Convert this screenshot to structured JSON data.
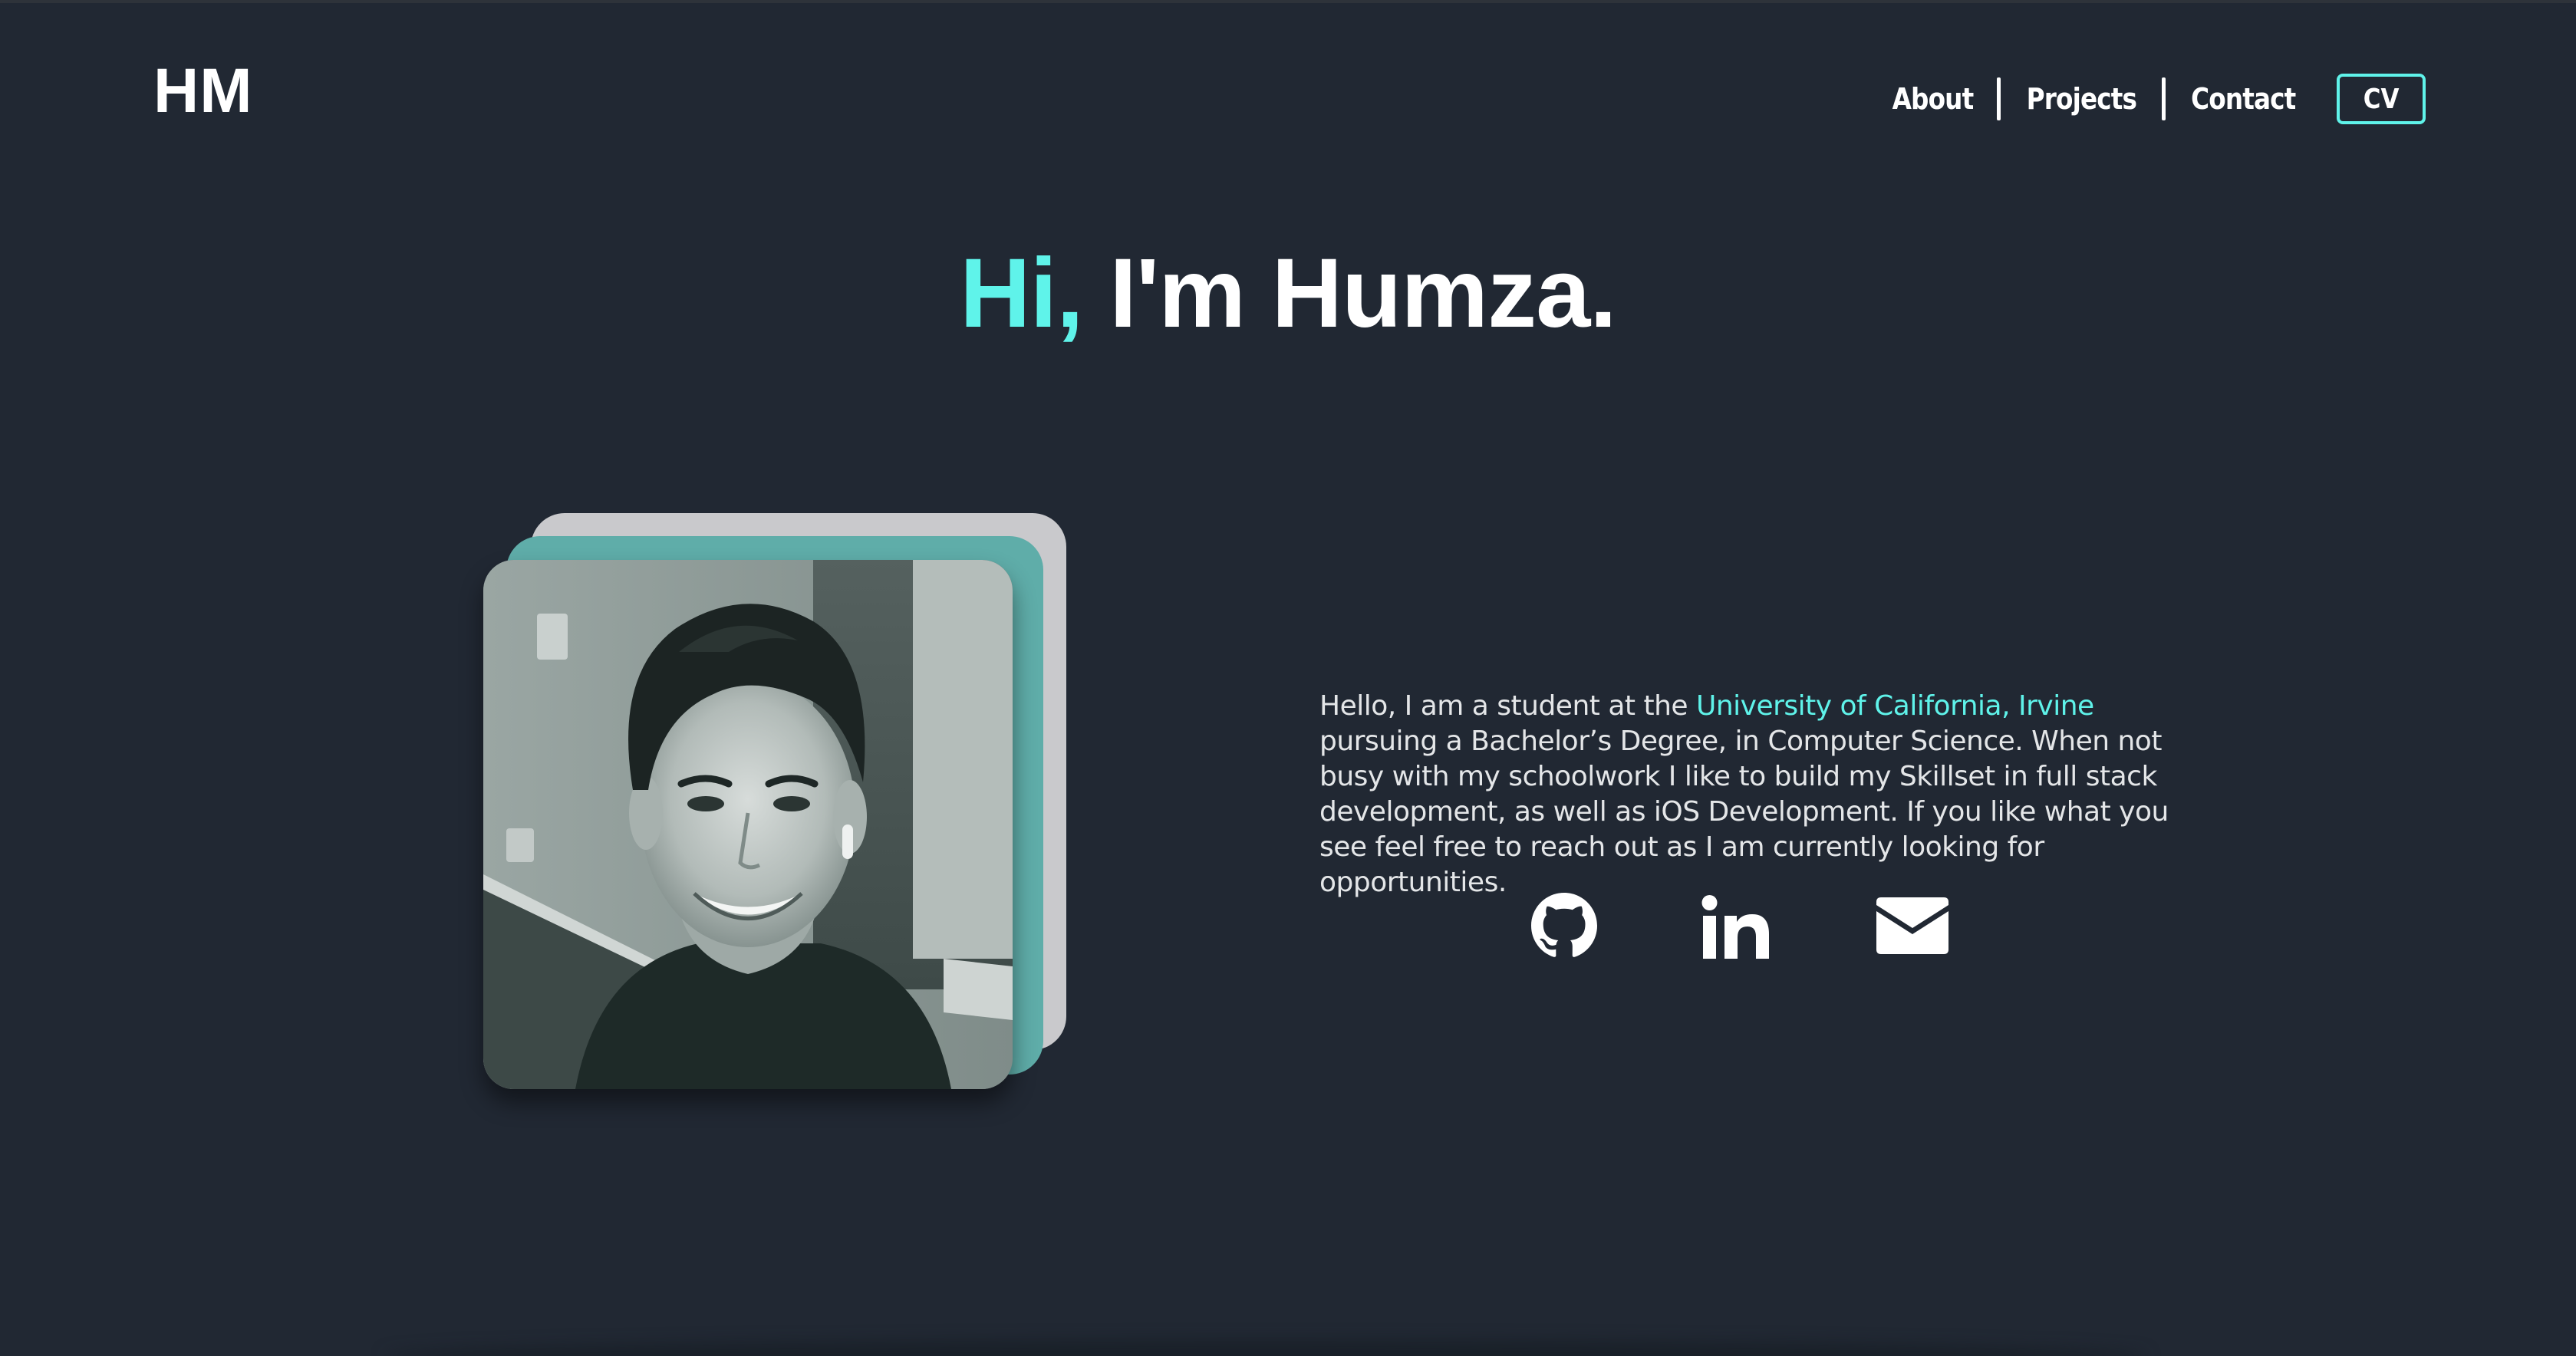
{
  "header": {
    "logo": "HM",
    "nav": [
      {
        "label": "About"
      },
      {
        "label": "Projects"
      },
      {
        "label": "Contact"
      }
    ],
    "cv_label": "CV"
  },
  "hero": {
    "greeting": "Hi,",
    "name_text": "I'm Humza."
  },
  "bio": {
    "part1": "Hello, I am a student at the ",
    "highlight": "University of California, Irvine",
    "part2": " pursuing a Bachelor’s Degree, in Computer Science. When not busy with my schoolwork I like to build my Skillset in full stack development, as well as iOS Development. If you like what you see feel free to reach out as I am currently looking for opportunities."
  },
  "social": [
    {
      "icon": "github-icon"
    },
    {
      "icon": "linkedin-icon"
    },
    {
      "icon": "mail-icon"
    }
  ],
  "colors": {
    "background": "#212833",
    "accent": "#5ff3ea",
    "text": "#ffffff",
    "card_teal": "#5fada9",
    "card_gray": "#c9c9cc"
  }
}
